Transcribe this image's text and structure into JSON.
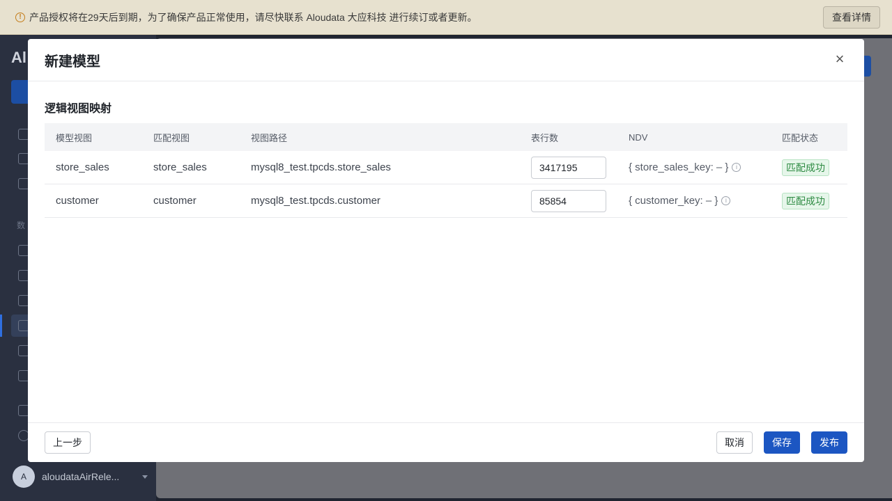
{
  "banner": {
    "message": "产品授权将在29天后到期，为了确保产品正常使用，请尽快联系 Aloudata 大应科技 进行续订或者更新。",
    "detail_button": "查看详情"
  },
  "background": {
    "logo_text": "Al",
    "section_label": "数",
    "user": {
      "avatar_initial": "A",
      "name": "aloudataAirRele..."
    }
  },
  "modal": {
    "title": "新建模型",
    "section_title": "逻辑视图映射",
    "table": {
      "headers": [
        "模型视图",
        "匹配视图",
        "视图路径",
        "表行数",
        "NDV",
        "匹配状态"
      ],
      "rows": [
        {
          "model_view": "store_sales",
          "match_view": "store_sales",
          "view_path": "mysql8_test.tpcds.store_sales",
          "row_count": "3417195",
          "ndv": "{ store_sales_key: – }",
          "status": "匹配成功"
        },
        {
          "model_view": "customer",
          "match_view": "customer",
          "view_path": "mysql8_test.tpcds.customer",
          "row_count": "85854",
          "ndv": "{ customer_key: – }",
          "status": "匹配成功"
        }
      ]
    },
    "footer": {
      "prev_label": "上一步",
      "cancel_label": "取消",
      "save_label": "保存",
      "publish_label": "发布"
    }
  },
  "colors": {
    "primary": "#1c56c2",
    "success": "#2e8b43",
    "banner_bg": "#e7e1cf"
  }
}
